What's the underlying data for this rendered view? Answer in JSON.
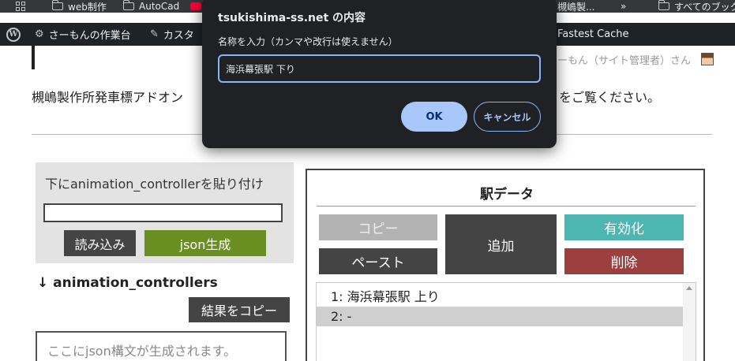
{
  "bookmarks": {
    "items": [
      {
        "label": "web制作"
      },
      {
        "label": "AutoCad"
      },
      {
        "label": "槻嶋製..."
      },
      {
        "label": "すべてのブックマーク"
      }
    ],
    "overflow_label": "»"
  },
  "adminbar": {
    "site_name": "さーもんの作業台",
    "customize_label": "カスタ",
    "cache_label": "Fastest Cache",
    "howdy": "ーもん（サイト管理者）さん"
  },
  "page": {
    "intro_text": "槻嶋製作所発車標アドオン",
    "intro_tail": "をご覧ください。",
    "left_panel": {
      "title": "下にanimation_controllerを貼り付け",
      "input_value": "",
      "load_button": "読み込み",
      "json_button": "json生成"
    },
    "animation_heading": "↓ animation_controllers",
    "copy_result_button": "結果をコピー",
    "json_placeholder": "ここにjson構文が生成されます。",
    "station": {
      "title": "駅データ",
      "copy_button": "コピー",
      "paste_button": "ペースト",
      "add_button": "追加",
      "enable_button": "有効化",
      "delete_button": "削除",
      "items": [
        {
          "label": "1: 海浜幕張駅 上り",
          "selected": false
        },
        {
          "label": "2: -",
          "selected": true
        }
      ]
    }
  },
  "dialog": {
    "title": "tsukishima-ss.net の内容",
    "message": "名称を入力（カンマや改行は使えません）",
    "input_value": "海浜幕張駅 下り",
    "ok_label": "OK",
    "cancel_label": "キャンセル"
  },
  "colors": {
    "json_button": "#6b8e23",
    "enable_button": "#4db6b0",
    "delete_button": "#9c3f3f",
    "dialog_bg": "#202124",
    "dialog_ok": "#a8c7fa"
  }
}
